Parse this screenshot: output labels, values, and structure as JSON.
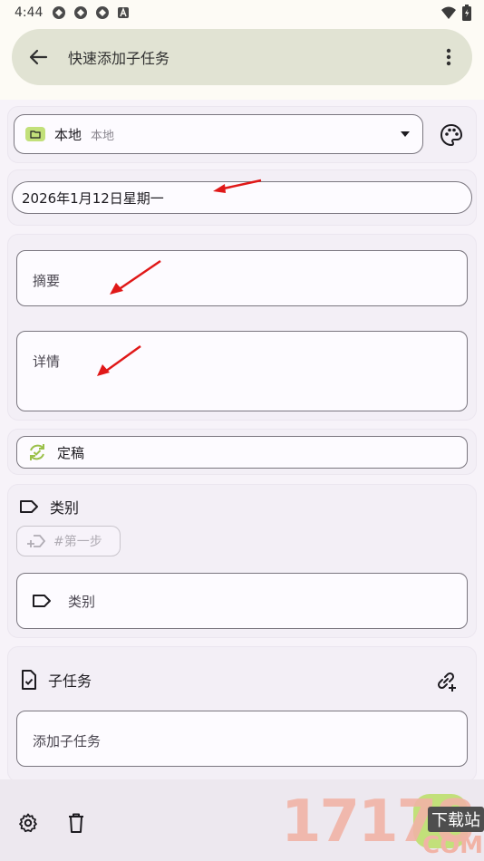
{
  "status_bar": {
    "time": "4:44"
  },
  "app_bar": {
    "title": "快速添加子任务"
  },
  "source": {
    "name": "本地",
    "sub": "本地"
  },
  "date": {
    "value": "2026年1月12日星期一"
  },
  "fields": {
    "summary_label": "摘要",
    "details_label": "详情"
  },
  "status_chip": {
    "label": "定稿"
  },
  "category": {
    "heading": "类别",
    "chip_label": "#第一步",
    "input_label": "类别"
  },
  "subtasks": {
    "heading": "子任务",
    "input_label": "添加子任务"
  },
  "watermark": {
    "number": "17178",
    "site_label": "下载站",
    "com": "COM"
  },
  "colors": {
    "accent_green": "#c2e07a",
    "arrow_red": "#e01818",
    "app_bar_bg": "#e1e3d3"
  }
}
